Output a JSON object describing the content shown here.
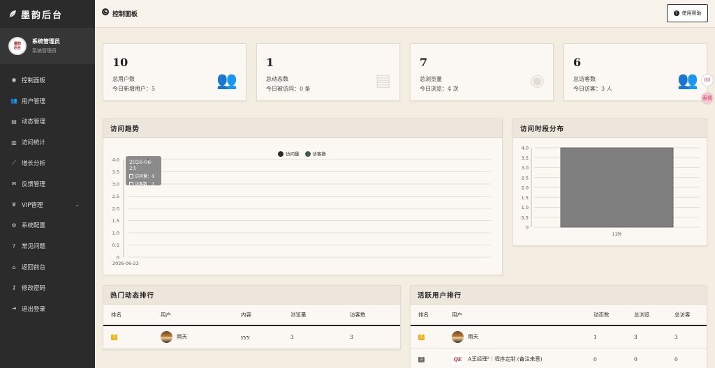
{
  "app": {
    "logo_text": "墨韵后台"
  },
  "user": {
    "avatar_text": "墨韵\n后台",
    "name": "系统管理员",
    "role": "系统管理员"
  },
  "nav": [
    {
      "icon": "dashboard-icon",
      "glyph": "◉",
      "label": "控制面板"
    },
    {
      "icon": "users-icon",
      "glyph": "👥",
      "label": "用户管理"
    },
    {
      "icon": "document-icon",
      "glyph": "▤",
      "label": "动态管理"
    },
    {
      "icon": "bar-chart-icon",
      "glyph": "▥",
      "label": "访问统计"
    },
    {
      "icon": "line-chart-icon",
      "glyph": "⟋",
      "label": "增长分析"
    },
    {
      "icon": "comments-icon",
      "glyph": "✉",
      "label": "反馈管理"
    },
    {
      "icon": "crown-icon",
      "glyph": "♛",
      "label": "VIP管理",
      "chevron": "⌄"
    },
    {
      "icon": "gear-icon",
      "glyph": "⚙",
      "label": "系统配置"
    },
    {
      "icon": "question-icon",
      "glyph": "?",
      "label": "常见问题"
    },
    {
      "icon": "home-icon",
      "glyph": "⌂",
      "label": "返回前台"
    },
    {
      "icon": "key-icon",
      "glyph": "⚷",
      "label": "修改密码"
    },
    {
      "icon": "logout-icon",
      "glyph": "⇥",
      "label": "退出登录"
    }
  ],
  "header": {
    "title": "控制面板",
    "help_label": "使用帮助"
  },
  "stats": [
    {
      "value": "10",
      "label": "总用户数",
      "sub": "今日新增用户：5",
      "icon": "users-icon",
      "glyph": "👥"
    },
    {
      "value": "1",
      "label": "总动态数",
      "sub": "今日被访问：0 条",
      "icon": "document-icon",
      "glyph": "▤"
    },
    {
      "value": "7",
      "label": "总浏览量",
      "sub": "今日浏览：4 次",
      "icon": "eye-icon",
      "glyph": "◉"
    },
    {
      "value": "6",
      "label": "总访客数",
      "sub": "今日访客：3 人",
      "icon": "users-icon",
      "glyph": "👥"
    }
  ],
  "trend": {
    "title": "访问趋势",
    "tooltip": {
      "date": "2026-06-23",
      "views": "访问量：4",
      "visitors": "访客数：3"
    }
  },
  "hourly": {
    "title": "访问时段分布"
  },
  "colors": {
    "views": "#2a2a2a",
    "visitors": "#3e5e48",
    "bar": "#7f7f7f"
  },
  "chart_data": [
    {
      "type": "line",
      "x": [
        "2026-06-23"
      ],
      "series": [
        {
          "name": "访问量",
          "values": [
            4
          ]
        },
        {
          "name": "访客数",
          "values": [
            3
          ]
        }
      ],
      "yticks": [
        "0",
        "0.5",
        "1.0",
        "1.5",
        "2.0",
        "2.5",
        "3.0",
        "3.5",
        "4.0"
      ],
      "ylim": [
        0,
        4
      ],
      "legend": "top-center",
      "grid": true
    },
    {
      "type": "bar",
      "categories": [
        "11时"
      ],
      "values": [
        4
      ],
      "yticks": [
        "0",
        "0.5",
        "1.0",
        "1.5",
        "2.0",
        "2.5",
        "3.0",
        "3.5",
        "4.0"
      ],
      "ylim": [
        0,
        4
      ],
      "grid": true
    }
  ],
  "hot_posts": {
    "title": "热门动态排行",
    "columns": [
      "排名",
      "用户",
      "内容",
      "浏览量",
      "访客数"
    ],
    "rows": [
      {
        "rank": "1",
        "user": "雨天",
        "content": "yyy",
        "views": "3",
        "visitors": "3"
      }
    ]
  },
  "active_users": {
    "title": "活跃用户排行",
    "columns": [
      "排名",
      "用户",
      "动态数",
      "总浏览",
      "总访客"
    ],
    "rows": [
      {
        "rank": "1",
        "user": "雨天",
        "posts": "1",
        "views": "3",
        "visitors": "3"
      },
      {
        "rank": "2",
        "user": "A王经理²｜程序定制 (备注来意)",
        "posts": "0",
        "views": "0",
        "visitors": "0",
        "avatar_text": "QE"
      }
    ]
  },
  "float": {
    "top": "80",
    "bottom": "表情"
  }
}
